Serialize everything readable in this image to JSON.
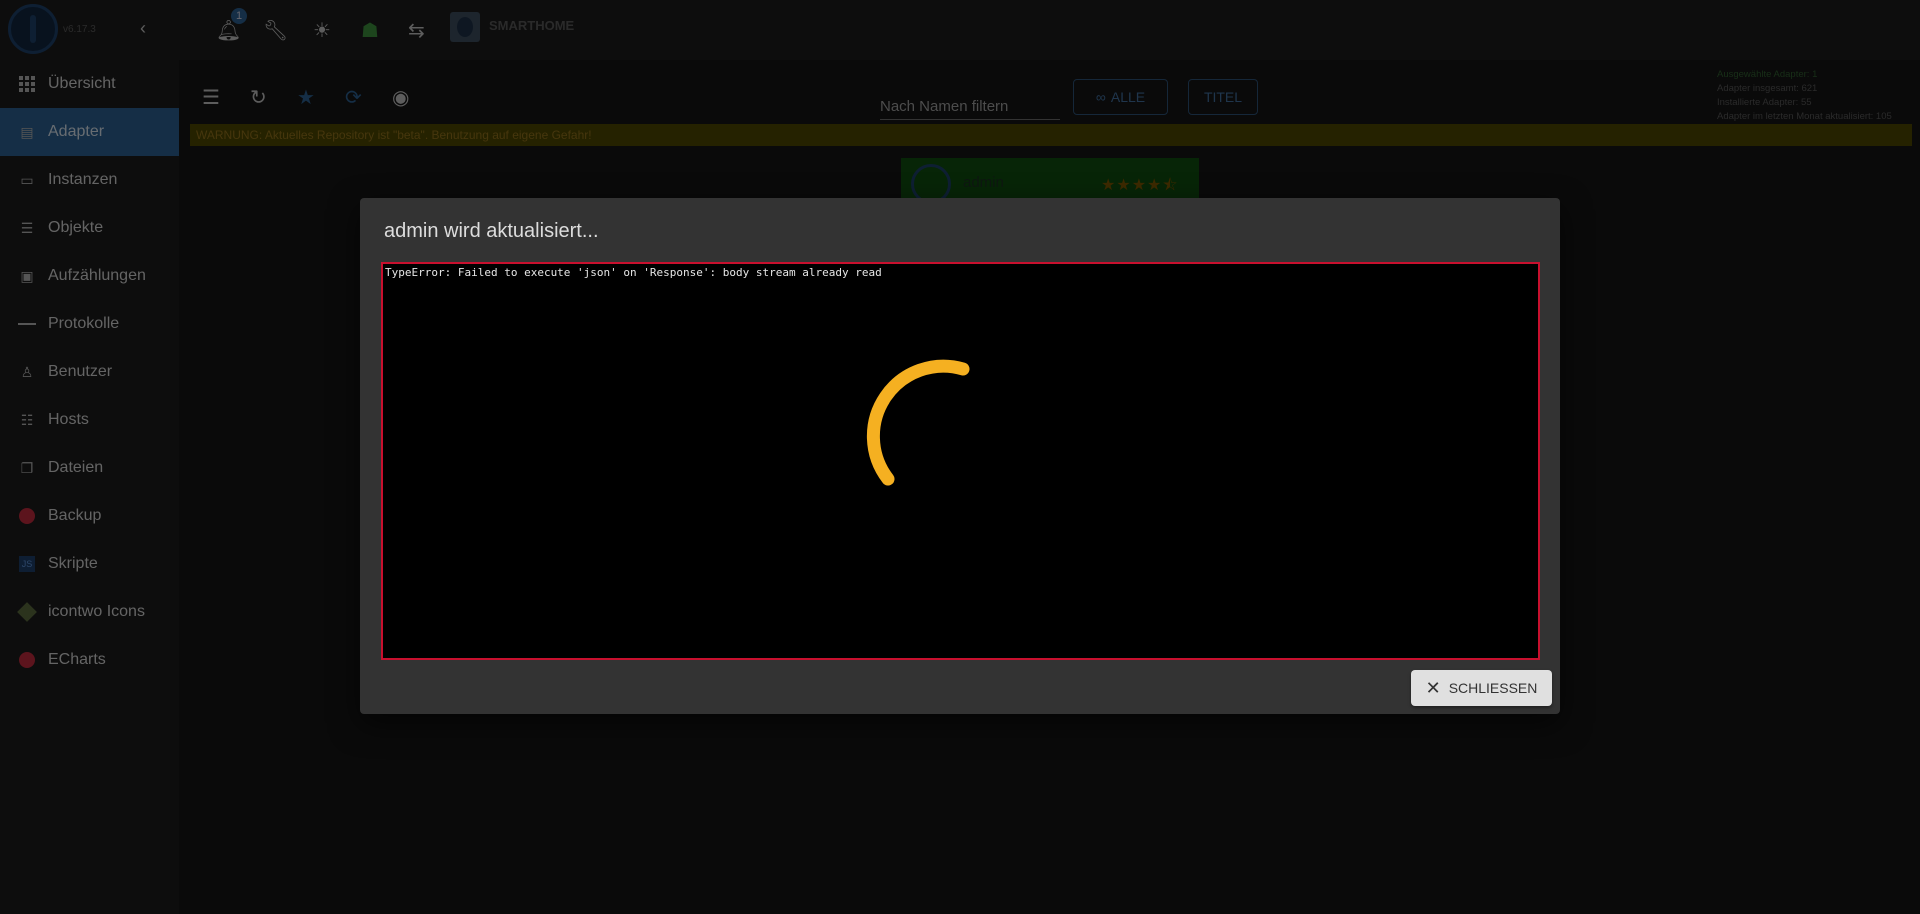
{
  "app": {
    "version": "v6.17.3",
    "host_title": "SMARTHOME",
    "notifications_count": "1"
  },
  "sidebar": {
    "items": [
      {
        "label": "Übersicht",
        "icon": "grid-icon",
        "active": false
      },
      {
        "label": "Adapter",
        "icon": "store-icon",
        "active": true
      },
      {
        "label": "Instanzen",
        "icon": "instances-icon",
        "active": false
      },
      {
        "label": "Objekte",
        "icon": "list-icon",
        "active": false
      },
      {
        "label": "Aufzählungen",
        "icon": "enum-icon",
        "active": false
      },
      {
        "label": "Protokolle",
        "icon": "log-icon",
        "active": false
      },
      {
        "label": "Benutzer",
        "icon": "user-icon",
        "active": false
      },
      {
        "label": "Hosts",
        "icon": "hosts-icon",
        "active": false
      },
      {
        "label": "Dateien",
        "icon": "files-icon",
        "active": false
      },
      {
        "label": "Backup",
        "icon": "backup-icon",
        "active": false
      },
      {
        "label": "Skripte",
        "icon": "script-icon",
        "active": false
      },
      {
        "label": "icontwo Icons",
        "icon": "icontwo-icon",
        "active": false
      },
      {
        "label": "ECharts",
        "icon": "echarts-icon",
        "active": false
      }
    ]
  },
  "toolbar": {
    "filter_placeholder": "Nach Namen filtern",
    "all_label": "ALLE",
    "title_label": "TITEL"
  },
  "stats": {
    "selected": "Ausgewählte Adapter: 1",
    "total": "Adapter insgesamt: 621",
    "installed": "Installierte Adapter: 55",
    "updated": "Adapter im letzten Monat aktualisiert: 105"
  },
  "warning": "WARNUNG: Aktuelles Repository ist \"beta\". Benutzung auf eigene Gefahr!",
  "adapter_card": {
    "name": "admin",
    "stars": "★★★★⯪"
  },
  "modal": {
    "title": "admin wird aktualisiert...",
    "console_text": "TypeError: Failed to execute 'json' on 'Response': body stream already read",
    "close_label": "SCHLIESSEN"
  },
  "colors": {
    "accent": "#2a5d8c",
    "spinner": "#f5b021",
    "error_border": "#c8102e"
  }
}
